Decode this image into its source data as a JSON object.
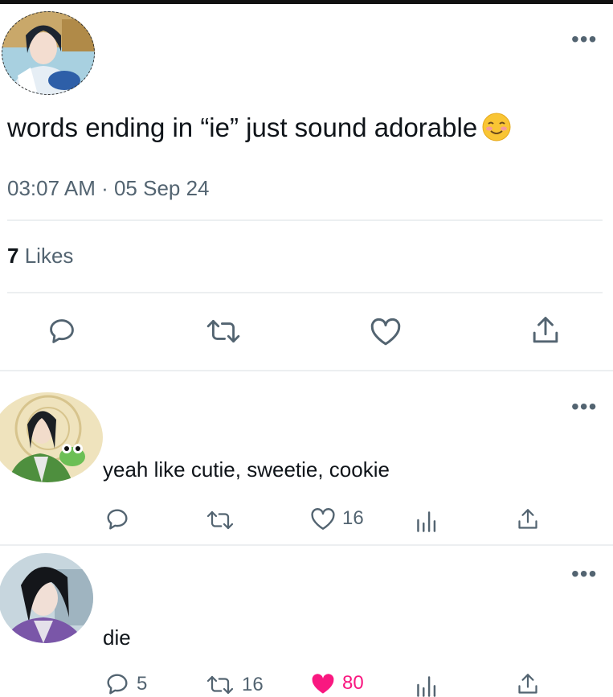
{
  "tweet": {
    "text": "words ending in “ie” just sound adorable",
    "emoji": "smiling-face-emoji",
    "timestamp": "03:07 AM · 05 Sep 24",
    "likes_count": "7",
    "likes_label": "Likes",
    "more_label": "•••"
  },
  "replies": [
    {
      "text": "yeah like cutie, sweetie, cookie",
      "more_label": "•••",
      "reply_count": "",
      "retweet_count": "",
      "like_count": "16",
      "liked": false
    },
    {
      "text": "die",
      "more_label": "•••",
      "reply_count": "5",
      "retweet_count": "16",
      "like_count": "80",
      "liked": true
    }
  ],
  "colors": {
    "text": "#0f1419",
    "secondary": "#536471",
    "divider": "#eceff1",
    "like_pink": "#f91880"
  }
}
